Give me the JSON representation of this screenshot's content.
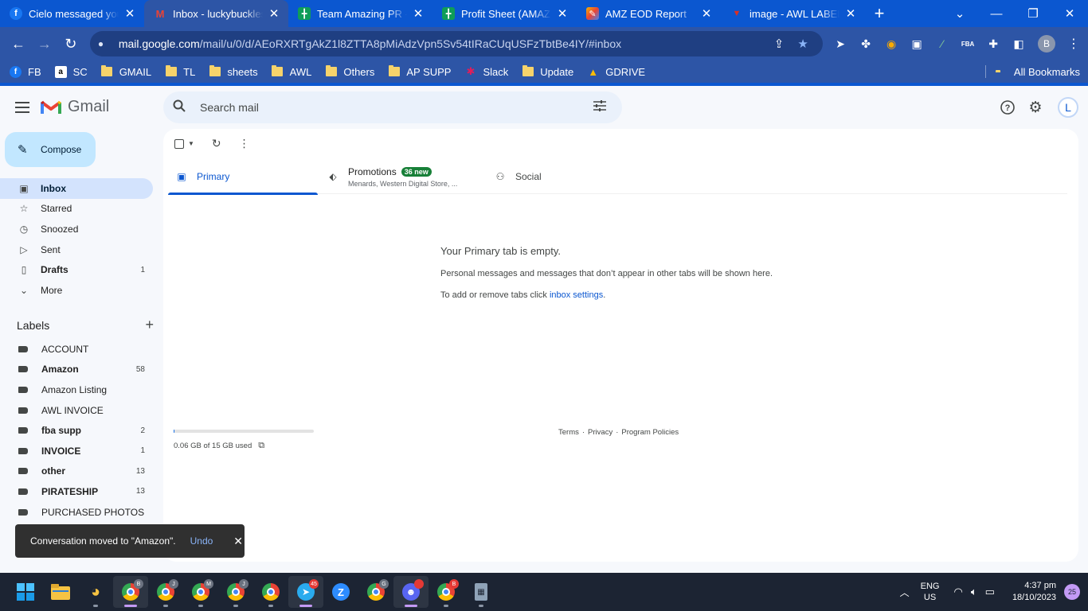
{
  "browser": {
    "tabs": [
      {
        "title": "Cielo messaged you",
        "icon": "facebook-icon",
        "color": "#1877f2"
      },
      {
        "title": "Inbox - luckybuckless",
        "icon": "gmail-icon",
        "color": "#ea4335",
        "active": true
      },
      {
        "title": "Team Amazing PR - G",
        "icon": "sheets-icon",
        "color": "#0f9d58"
      },
      {
        "title": "Profit Sheet (AMAZIN",
        "icon": "sheets-icon",
        "color": "#0f9d58"
      },
      {
        "title": "AMZ EOD Report",
        "icon": "report-icon",
        "color": "#f4b400"
      },
      {
        "title": "image - AWL LABEL",
        "icon": "image-icon",
        "color": "#d93025"
      }
    ],
    "url_host": "mail.google.com",
    "url_path": "/mail/u/0/d/AEoRXRTgAkZ1l8ZTTA8pMiAdzVpn5Sv54tIRaCUqUSFzTbtBe4IY/#inbox",
    "profile_initial": "B",
    "bookmarks": [
      {
        "label": "FB",
        "type": "facebook"
      },
      {
        "label": "SC",
        "type": "amazon"
      },
      {
        "label": "GMAIL",
        "type": "folder"
      },
      {
        "label": "TL",
        "type": "folder"
      },
      {
        "label": "sheets",
        "type": "folder"
      },
      {
        "label": "AWL",
        "type": "folder"
      },
      {
        "label": "Others",
        "type": "folder"
      },
      {
        "label": "AP SUPP",
        "type": "folder"
      },
      {
        "label": "Slack",
        "type": "slack"
      },
      {
        "label": "Update",
        "type": "folder"
      },
      {
        "label": "GDRIVE",
        "type": "drive"
      }
    ],
    "all_bookmarks": "All Bookmarks"
  },
  "gmail": {
    "logo_text": "Gmail",
    "search_placeholder": "Search mail",
    "avatar_initial": "L",
    "compose_label": "Compose",
    "nav": [
      {
        "label": "Inbox",
        "icon": "inbox-icon",
        "count": "",
        "active": true
      },
      {
        "label": "Starred",
        "icon": "star-icon",
        "count": ""
      },
      {
        "label": "Snoozed",
        "icon": "clock-icon",
        "count": ""
      },
      {
        "label": "Sent",
        "icon": "send-icon",
        "count": ""
      },
      {
        "label": "Drafts",
        "icon": "draft-icon",
        "count": "1",
        "bold": true
      },
      {
        "label": "More",
        "icon": "chevron-down-icon",
        "count": ""
      }
    ],
    "labels_heading": "Labels",
    "labels": [
      {
        "name": "ACCOUNT",
        "count": "",
        "bold": false
      },
      {
        "name": "Amazon",
        "count": "58",
        "bold": true
      },
      {
        "name": "Amazon Listing",
        "count": "",
        "bold": false
      },
      {
        "name": "AWL INVOICE",
        "count": "",
        "bold": false
      },
      {
        "name": "fba supp",
        "count": "2",
        "bold": true
      },
      {
        "name": "INVOICE",
        "count": "1",
        "bold": true
      },
      {
        "name": "other",
        "count": "13",
        "bold": true
      },
      {
        "name": "PIRATESHIP",
        "count": "13",
        "bold": true
      },
      {
        "name": "PURCHASED PHOTOS",
        "count": "",
        "bold": false
      }
    ],
    "inbox_tabs": {
      "primary": "Primary",
      "promotions": "Promotions",
      "promotions_badge": "36 new",
      "promotions_sub": "Menards, Western Digital Store, ...",
      "social": "Social"
    },
    "empty_title": "Your Primary tab is empty.",
    "empty_desc": "Personal messages and messages that don’t appear in other tabs will be shown here.",
    "empty_link_prefix": "To add or remove tabs click ",
    "empty_link": "inbox settings",
    "empty_link_suffix": ".",
    "storage_text": "0.06 GB of 15 GB used",
    "storage_fraction": 0.004,
    "footer": [
      "Terms",
      "Privacy",
      "Program Policies"
    ],
    "snackbar": {
      "message": "Conversation moved to \"Amazon\".",
      "undo": "Undo"
    }
  },
  "taskbar": {
    "lang_top": "ENG",
    "lang_bottom": "US",
    "time": "4:37 pm",
    "date": "18/10/2023",
    "notifications": "25",
    "telegram_badge": "45"
  }
}
